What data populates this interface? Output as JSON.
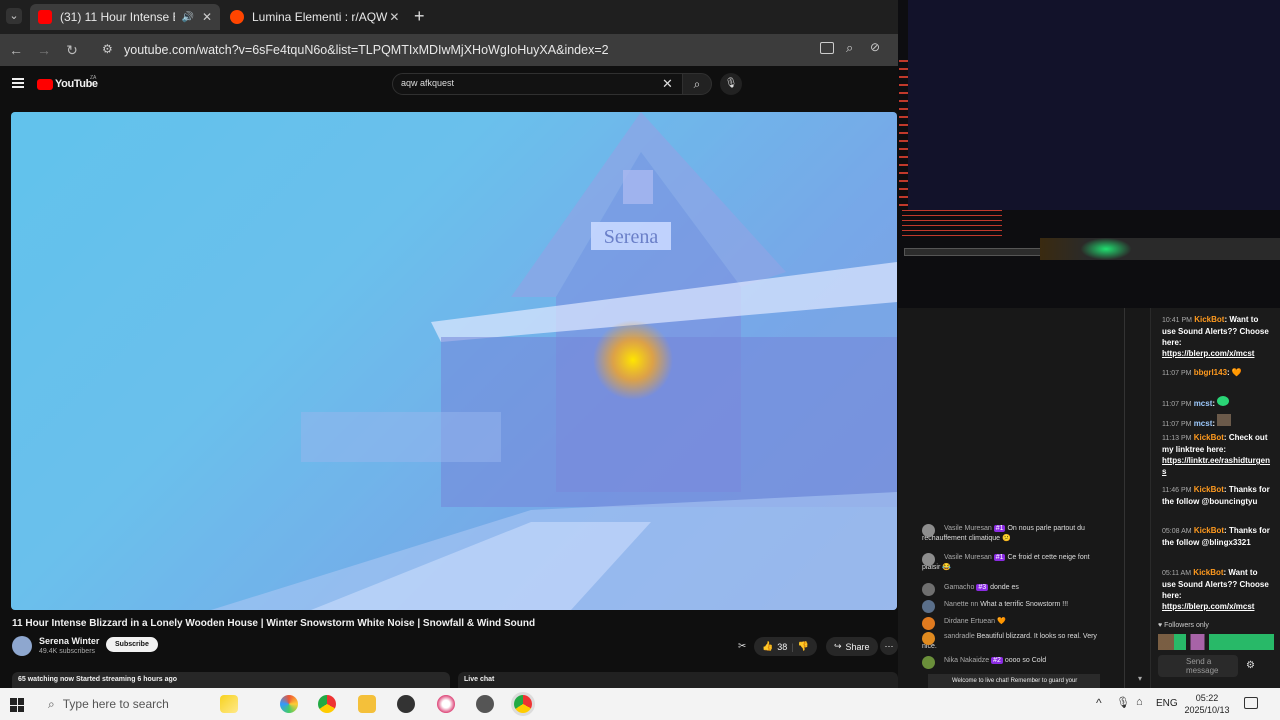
{
  "browser": {
    "tabs": [
      {
        "title": "(31) 11 Hour Intense Blizza",
        "active": true,
        "favicon_color": "#ff0000"
      },
      {
        "title": "Lumina Elementi : r/AQW",
        "active": false,
        "favicon_color": "#ff4500"
      }
    ],
    "url": "youtube.com/watch?v=6sFe4tquN6o&list=TLPQMTIxMDIwMjXHoWgIoHuyXA&index=2"
  },
  "youtube": {
    "logo": "YouTube",
    "country": "ZA",
    "search_value": "aqw afkquest",
    "video_sign": "Serena",
    "video_title": "11 Hour Intense Blizzard in a Lonely Wooden House | Winter Snowstorm White Noise | Snowfall & Wind Sound",
    "channel": "Serena Winter",
    "subscribers": "49.4K subscribers",
    "subscribe_label": "Subscribe",
    "likes": "38",
    "share_label": "Share",
    "watching": "65 watching now  Started streaming 6 hours ago",
    "live_chat_label": "Live chat",
    "chat_messages": [
      {
        "name": "Vasile Muresan",
        "badge": "#1",
        "text": "On nous parle partout du réchauffement climatique 😕",
        "color": "#8d8d8d"
      },
      {
        "name": "Vasile Muresan",
        "badge": "#1",
        "text": "Ce froid et cette neige font plaisir 😂",
        "color": "#8d8d8d"
      },
      {
        "name": "Gamacho",
        "badge": "#3",
        "text": "donde es",
        "color": "#6f6f6f"
      },
      {
        "name": "Nanette nn",
        "badge": "",
        "text": "What a terrific Snowstorm !!!",
        "color": "#5a6f8a"
      },
      {
        "name": "Dirdane Ertuean",
        "badge": "",
        "text": "🧡",
        "color": "#e07a1f"
      },
      {
        "name": "sandradle",
        "badge": "",
        "text": "Beautiful blizzard. It looks so real. Very nice.",
        "color": "#e08a1f"
      },
      {
        "name": "Nika Nakaidze",
        "badge": "#2",
        "text": "oooo so Cold",
        "color": "#6a8f3a"
      }
    ],
    "chat_welcome": "Welcome to live chat! Remember to guard your"
  },
  "kick_chat": {
    "messages": [
      {
        "time": "10:41 PM",
        "user": "KickBot",
        "text": "Want to use Sound Alerts?? Choose here:",
        "link": "https://blerp.com/x/mcst"
      },
      {
        "time": "11:07 PM",
        "user": "bbgrl143",
        "text": "🧡",
        "link": ""
      },
      {
        "time": "11:07 PM",
        "user": "mcst",
        "text": "",
        "link": ""
      },
      {
        "time": "11:07 PM",
        "user": "mcst",
        "text": "",
        "link": ""
      },
      {
        "time": "11:13 PM",
        "user": "KickBot",
        "text": "Check out my linktree here:",
        "link": "https://linktr.ee/rashidturgen s"
      },
      {
        "time": "11:46 PM",
        "user": "KickBot",
        "text": "Thanks for the follow @bouncingtyu",
        "link": ""
      },
      {
        "time": "05:08 AM",
        "user": "KickBot",
        "text": "Thanks for the follow @blingx3321",
        "link": ""
      },
      {
        "time": "05:11 AM",
        "user": "KickBot",
        "text": "Want to use Sound Alerts?? Choose here:",
        "link": "https://blerp.com/x/mcst"
      }
    ],
    "followers_only": "Followers only",
    "send_placeholder": "Send a message"
  },
  "taskbar": {
    "search_placeholder": "Type here to search",
    "language": "ENG",
    "time": "05:22",
    "date": "2025/10/13"
  }
}
